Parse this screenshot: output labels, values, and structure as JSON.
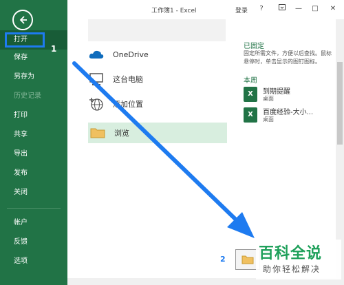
{
  "window": {
    "title": "工作簿1 - Excel",
    "login": "登录",
    "help": "?",
    "minimize": "—",
    "restore": "□",
    "close": "✕"
  },
  "sidebar": {
    "items": [
      {
        "label": "打开"
      },
      {
        "label": "保存"
      },
      {
        "label": "另存为"
      },
      {
        "label": "历史记录"
      },
      {
        "label": "打印"
      },
      {
        "label": "共享"
      },
      {
        "label": "导出"
      },
      {
        "label": "发布"
      },
      {
        "label": "关闭"
      },
      {
        "label": "帐户"
      },
      {
        "label": "反馈"
      },
      {
        "label": "选项"
      }
    ],
    "badge": "1"
  },
  "places": {
    "items": [
      {
        "label": "OneDrive"
      },
      {
        "label": "这台电脑"
      },
      {
        "label": "添加位置"
      },
      {
        "label": "浏览"
      }
    ]
  },
  "recent": {
    "pinned_title": "已固定",
    "pinned_desc": "固定所需文件，方便以后查找。鼠标悬停时，单击显示的图钉图标。",
    "week_title": "本周",
    "files": [
      {
        "name": "到期提醒",
        "location": "桌面"
      },
      {
        "name": "百度经验-大小...",
        "location": "桌面"
      }
    ]
  },
  "annotation": {
    "badge2": "2"
  },
  "watermark": {
    "big": "百科全说",
    "small": "助你轻松解决"
  },
  "colors": {
    "excel_green": "#217346",
    "arrow_blue": "#1e7bf0",
    "browse_highlight": "#d8eedf"
  }
}
